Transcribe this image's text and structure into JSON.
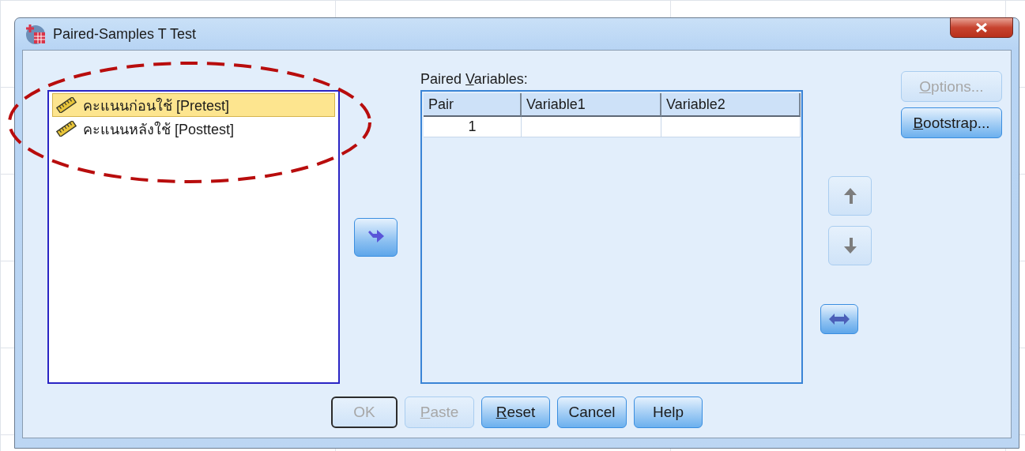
{
  "window": {
    "title": "Paired-Samples T Test"
  },
  "variables": [
    {
      "label": "คะแนนก่อนใช้ [Pretest]",
      "selected": true
    },
    {
      "label": "คะแนนหลังใช้ [Posttest]",
      "selected": false
    }
  ],
  "transfer_button": {
    "disabled": false
  },
  "paired_variables": {
    "label": {
      "before": "Paired ",
      "underlined": "V",
      "after": "ariables:"
    },
    "columns": [
      "Pair",
      "Variable1",
      "Variable2"
    ],
    "rows": [
      {
        "pair": "1"
      }
    ]
  },
  "move_buttons": [
    {
      "kind": "up",
      "disabled": true
    },
    {
      "kind": "down",
      "disabled": true
    },
    {
      "kind": "swap",
      "disabled": false
    }
  ],
  "side_buttons": [
    {
      "label": {
        "underlined": "O",
        "after": "ptions..."
      },
      "disabled": true
    },
    {
      "label": {
        "underlined": "B",
        "after": "ootstrap..."
      },
      "disabled": false
    }
  ],
  "buttons": [
    {
      "label": "OK",
      "disabled": true,
      "default": true
    },
    {
      "label": {
        "underlined": "P",
        "after": "aste"
      },
      "disabled": true,
      "default": false
    },
    {
      "label": {
        "underlined": "R",
        "after": "eset"
      },
      "disabled": false,
      "default": false
    },
    {
      "label": "Cancel",
      "disabled": false,
      "default": false
    },
    {
      "label": "Help",
      "disabled": false,
      "default": false
    }
  ]
}
